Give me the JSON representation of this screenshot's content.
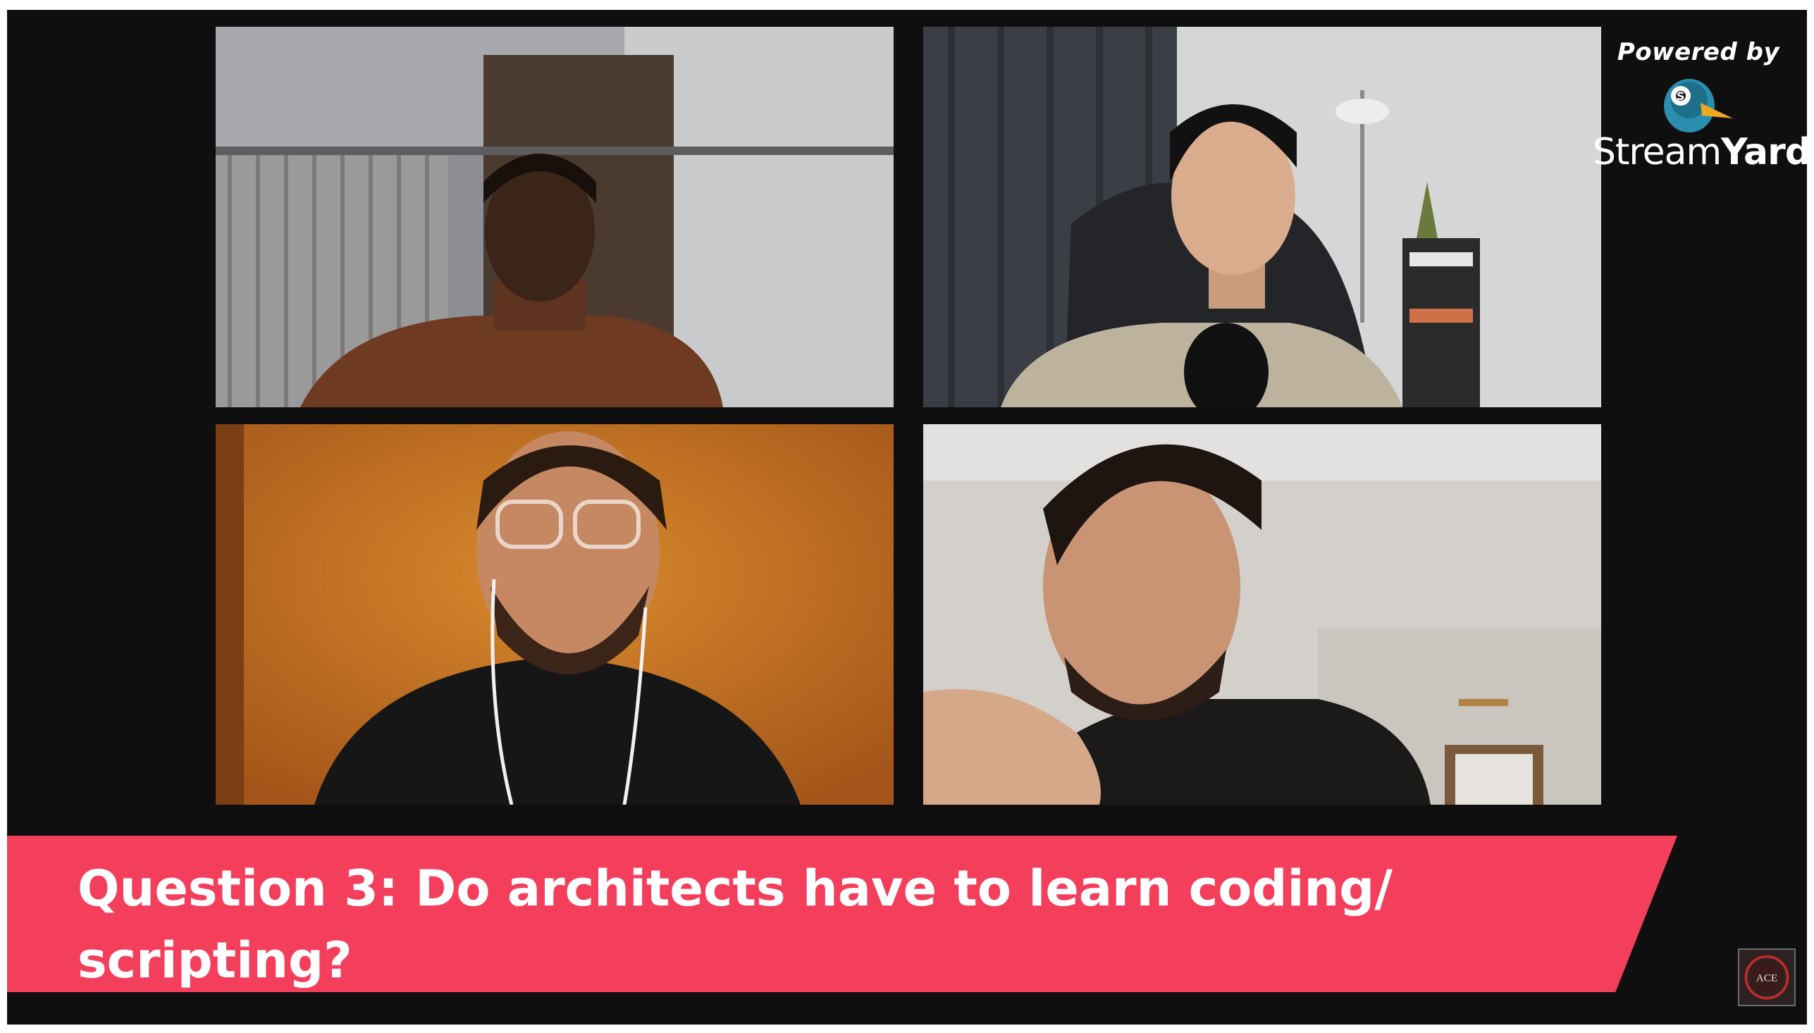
{
  "branding": {
    "powered_by": "Powered by",
    "name_light": "Stream",
    "name_bold": "Yard",
    "logo_icon": "streamyard-duck-icon"
  },
  "participants": [
    {
      "id": "participant-1",
      "description": "video-feed"
    },
    {
      "id": "participant-2",
      "description": "video-feed"
    },
    {
      "id": "participant-3",
      "description": "video-feed"
    },
    {
      "id": "participant-4",
      "description": "video-feed"
    }
  ],
  "banner": {
    "text": "Question 3: Do architects have to learn coding/ scripting?",
    "color": "#f43f5c"
  },
  "channel_logo": {
    "text": "ACE",
    "icon": "ace-channel-logo-icon"
  },
  "colors": {
    "background": "#0f0f10",
    "banner": "#f43f5c",
    "text": "#ffffff"
  }
}
